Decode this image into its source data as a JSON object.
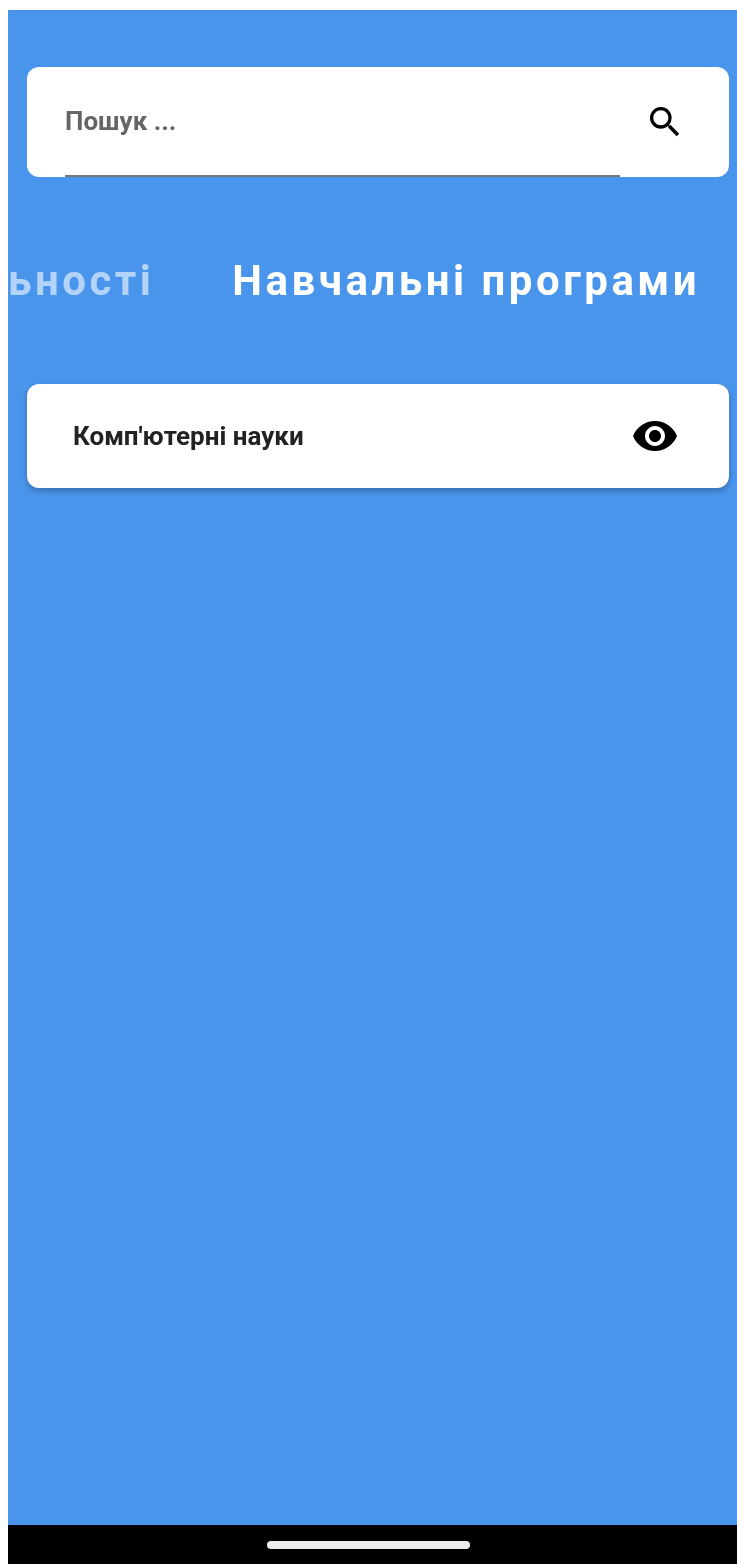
{
  "search": {
    "placeholder": "Пошук ..."
  },
  "tabs": [
    {
      "label": "ьності",
      "selected": false
    },
    {
      "label": "Навчальні програми",
      "selected": true
    }
  ],
  "programs": [
    {
      "title": "Комп'ютерні науки"
    }
  ]
}
